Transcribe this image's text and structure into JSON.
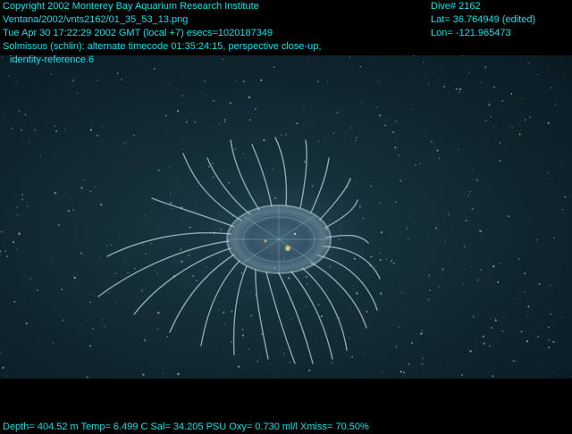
{
  "header": {
    "copyright": "Copyright 2002 Monterey Bay Aquarium Research Institute",
    "image_path": "Ventana/2002/vnts2162/01_35_53_13.png",
    "datetime": "Tue Apr 30 17:22:29 2002 GMT (local +7)  esecs=1020187349",
    "annotation_line1": "Solmissus (schlin): alternate timecode 01:35:24:15, perspective close-up,",
    "annotation_line2": "identity-reference 6"
  },
  "dive_info": {
    "dive": "Dive# 2162",
    "lat": "Lat= 36.764949 (edited)",
    "lon": "Lon= -121.965473"
  },
  "sensors": {
    "readout": "Depth= 404.52 m  Temp= 6.499 C  Sal= 34.205 PSU  Oxy= 0.730 ml/l  Xmiss= 70.50%"
  },
  "colors": {
    "overlay_text": "#00e5ee",
    "water": "#132c35",
    "letterbox": "#000000"
  },
  "subject": "jellyfish-photo"
}
